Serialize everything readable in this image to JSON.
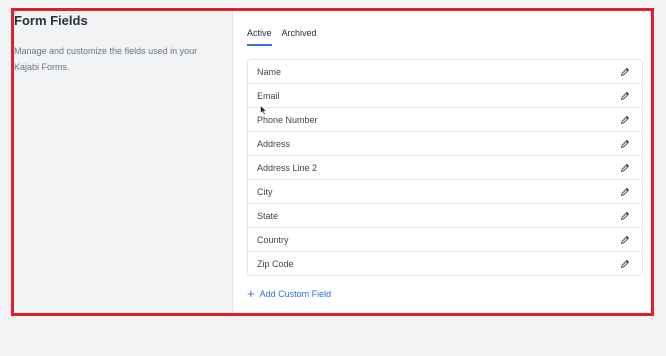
{
  "section": {
    "title": "Form Fields",
    "description": "Manage and customize the fields used in your Kajabi Forms."
  },
  "tabs": [
    {
      "label": "Active",
      "selected": true
    },
    {
      "label": "Archived",
      "selected": false
    }
  ],
  "fields": [
    {
      "label": "Name",
      "icon": "pencil-icon"
    },
    {
      "label": "Email",
      "icon": "pencil-icon"
    },
    {
      "label": "Phone Number",
      "icon": "pencil-icon"
    },
    {
      "label": "Address",
      "icon": "pencil-icon"
    },
    {
      "label": "Address Line 2",
      "icon": "pencil-icon"
    },
    {
      "label": "City",
      "icon": "pencil-icon"
    },
    {
      "label": "State",
      "icon": "pencil-icon"
    },
    {
      "label": "Country",
      "icon": "pencil-icon"
    },
    {
      "label": "Zip Code",
      "icon": "pencil-icon"
    }
  ],
  "actions": {
    "add_custom_field": "Add Custom Field"
  },
  "colors": {
    "accent": "#2f6fe4",
    "highlight_frame": "#e0202c",
    "background": "#f2f3f5"
  }
}
